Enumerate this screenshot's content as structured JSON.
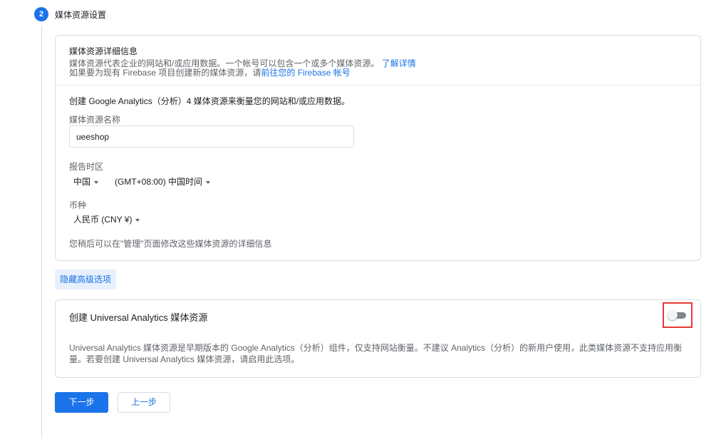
{
  "step": {
    "number": "2",
    "title": "媒体资源设置"
  },
  "details": {
    "title": "媒体资源详细信息",
    "line1_text": "媒体资源代表企业的网站和/或应用数据。一个帐号可以包含一个或多个媒体资源。",
    "learn_more": "了解详情",
    "line2_text": "如果要为现有 Firebase 项目创建新的媒体资源，请",
    "firebase_link": "前往您的 Firebase 帐号",
    "intro": "创建 Google Analytics（分析）4 媒体资源来衡量您的网站和/或应用数据。",
    "name_label": "媒体资源名称",
    "name_value": "ueeshop",
    "timezone_label": "报告时区",
    "country": "中国",
    "timezone": "(GMT+08:00) 中国时间",
    "currency_label": "币种",
    "currency": "人民币 (CNY ¥)",
    "note": "您稍后可以在\"管理\"页面修改这些媒体资源的详细信息"
  },
  "advanced_toggle": "隐藏高级选项",
  "universal": {
    "title": "创建 Universal Analytics 媒体资源",
    "description": "Universal Analytics 媒体资源是早期版本的 Google Analytics（分析）组件，仅支持网站衡量。不建议 Analytics（分析）的新用户使用，此类媒体资源不支持应用衡量。若要创建 Universal Analytics 媒体资源，请启用此选项。",
    "enabled": false
  },
  "buttons": {
    "next": "下一步",
    "back": "上一步"
  },
  "colors": {
    "accent": "#1a73e8",
    "highlight": "#e53935"
  }
}
